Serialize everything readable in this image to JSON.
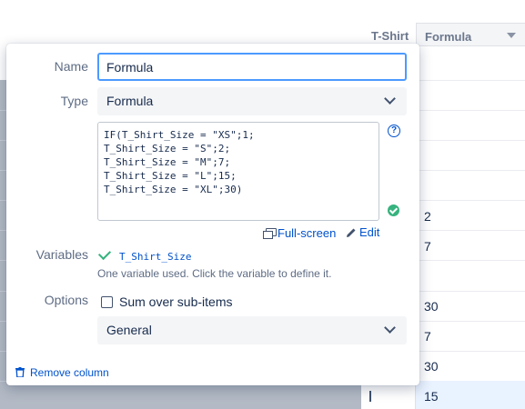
{
  "grid": {
    "columns": [
      {
        "label": "T-Shirt"
      },
      {
        "label": "Formula"
      }
    ],
    "formula_column_values": [
      "2",
      "7",
      "30",
      "7",
      "30",
      "15"
    ]
  },
  "dialog": {
    "name_label": "Name",
    "name_value": "Formula",
    "type_label": "Type",
    "type_value": "Formula",
    "formula_lines": [
      "IF(T_Shirt_Size = \"XS\";1;",
      "T_Shirt_Size = \"S\";2;",
      "T_Shirt_Size = \"M\";7;",
      "T_Shirt_Size = \"L\";15;",
      "T_Shirt_Size = \"XL\";30)"
    ],
    "help_glyph": "?",
    "fullscreen_link": "Full-screen",
    "edit_link": "Edit",
    "variables_label": "Variables",
    "variable_name": "T_Shirt_Size",
    "variables_hint": "One variable used. Click the variable to define it.",
    "options_label": "Options",
    "sum_over_label": "Sum over sub-items",
    "sum_over_checked": false,
    "format_value": "General",
    "remove_column": "Remove column"
  },
  "colors": {
    "accent": "#0052cc",
    "focus_border": "#4c9aff",
    "success": "#36b37e",
    "backdrop": "#b3bac5"
  }
}
